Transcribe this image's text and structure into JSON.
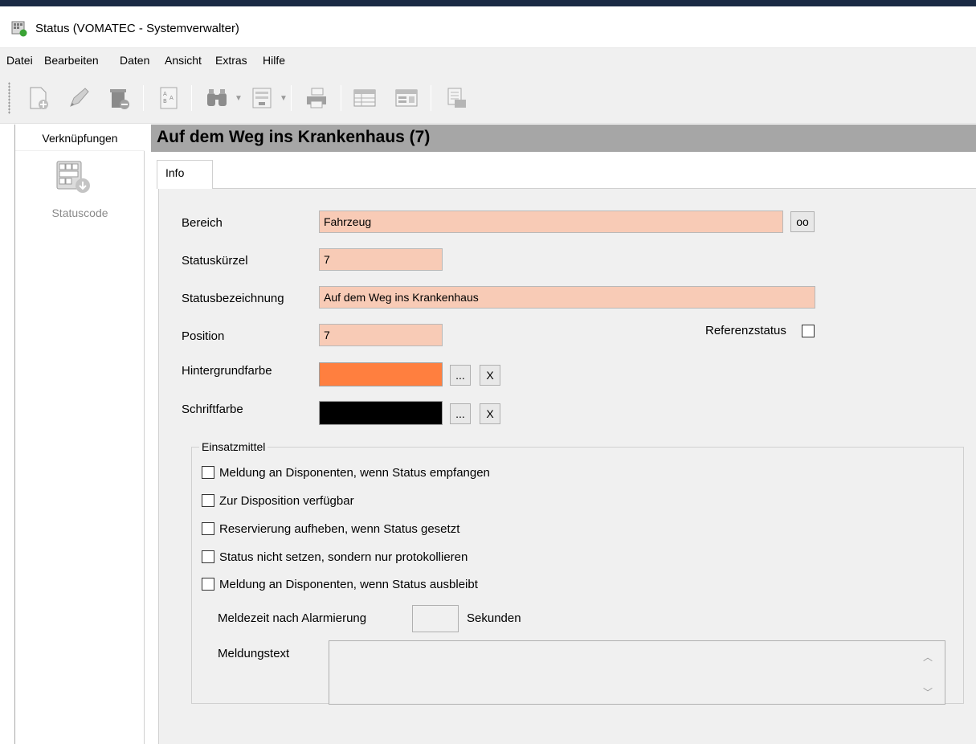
{
  "window": {
    "title": "Status (VOMATEC -  Systemverwalter)"
  },
  "menu": [
    "Datei",
    "Bearbeiten",
    "Daten",
    "Ansicht",
    "Extras",
    "Hilfe"
  ],
  "sidebar": {
    "header": "Verknüpfungen",
    "item_label": "Statuscode"
  },
  "header": {
    "title": "Auf dem Weg ins Krankenhaus (7)"
  },
  "tabs": [
    {
      "label": "Info"
    }
  ],
  "form": {
    "bereich": {
      "label": "Bereich",
      "value": "Fahrzeug",
      "button": "oo"
    },
    "statuskuerzel": {
      "label": "Statuskürzel",
      "value": "7"
    },
    "statusbezeichnung": {
      "label": "Statusbezeichnung",
      "value": "Auf dem Weg ins Krankenhaus"
    },
    "position": {
      "label": "Position",
      "value": "7"
    },
    "referenzstatus": {
      "label": "Referenzstatus",
      "checked": false
    },
    "hintergrundfarbe": {
      "label": "Hintergrundfarbe",
      "color": "#ff7f3f",
      "pick": "...",
      "clear": "X"
    },
    "schriftfarbe": {
      "label": "Schriftfarbe",
      "color": "#000000",
      "pick": "...",
      "clear": "X"
    }
  },
  "einsatzmittel": {
    "legend": "Einsatzmittel",
    "checkboxes": [
      {
        "label": "Meldung an Disponenten, wenn Status empfangen",
        "checked": false
      },
      {
        "label": "Zur Disposition verfügbar",
        "checked": false
      },
      {
        "label": "Reservierung aufheben, wenn Status gesetzt",
        "checked": false
      },
      {
        "label": "Status nicht setzen, sondern nur protokollieren",
        "checked": false
      },
      {
        "label": "Meldung an Disponenten, wenn Status ausbleibt",
        "checked": false
      }
    ],
    "meldezeit": {
      "label": "Meldezeit nach Alarmierung",
      "value": "",
      "unit": "Sekunden"
    },
    "meldungstext": {
      "label": "Meldungstext",
      "value": ""
    }
  },
  "colors": {
    "field_bg": "#f8cbb6",
    "header_bar": "#a6a6a6",
    "panel_bg": "#f0f0f0"
  }
}
